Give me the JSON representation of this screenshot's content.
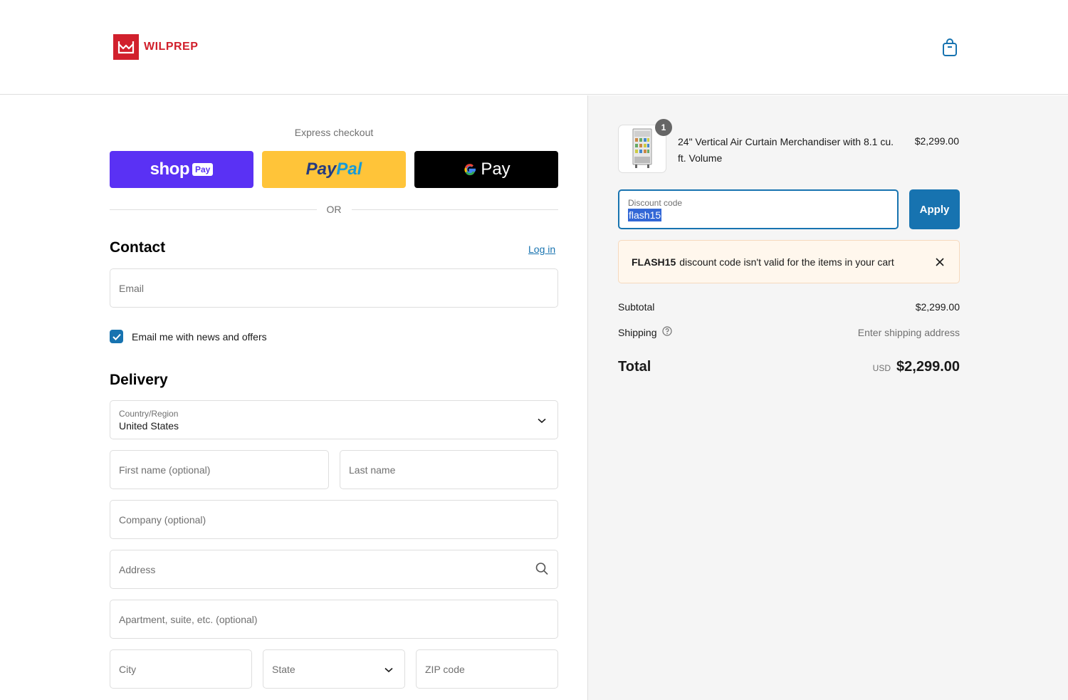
{
  "brand": {
    "name": "WILPREP",
    "logo_color": "#d1202c"
  },
  "header": {
    "cart_icon": "shopping-bag-icon"
  },
  "express": {
    "label": "Express checkout",
    "shop_pay": {
      "text": "shop",
      "badge": "Pay",
      "color": "#5a31f4"
    },
    "paypal": {
      "part1": "Pay",
      "part2": "Pal",
      "color": "#ffc439"
    },
    "gpay": {
      "g": "G",
      "text": "Pay",
      "color": "#000000"
    },
    "or_text": "OR"
  },
  "contact": {
    "title": "Contact",
    "login_link": "Log in",
    "email_placeholder": "Email",
    "newsletter_label": "Email me with news and offers",
    "newsletter_checked": true
  },
  "delivery": {
    "title": "Delivery",
    "country_label": "Country/Region",
    "country_value": "United States",
    "first_name_placeholder": "First name (optional)",
    "last_name_placeholder": "Last name",
    "company_placeholder": "Company (optional)",
    "address_placeholder": "Address",
    "apartment_placeholder": "Apartment, suite, etc. (optional)",
    "city_placeholder": "City",
    "state_placeholder": "State",
    "zip_placeholder": "ZIP code"
  },
  "order": {
    "product": {
      "name": "24\" Vertical Air Curtain Merchandiser with 8.1 cu. ft. Volume",
      "price": "$2,299.00",
      "quantity": "1"
    },
    "discount": {
      "label": "Discount code",
      "value": "flash15",
      "apply_label": "Apply"
    },
    "error": {
      "code": "FLASH15",
      "message": "discount code isn't valid for the items in your cart"
    },
    "subtotal_label": "Subtotal",
    "subtotal_value": "$2,299.00",
    "shipping_label": "Shipping",
    "shipping_value": "Enter shipping address",
    "total_label": "Total",
    "total_currency": "USD",
    "total_value": "$2,299.00"
  },
  "colors": {
    "accent": "#1773b0",
    "error_bg": "#fff7ed",
    "sidebar_bg": "#f5f5f5"
  }
}
